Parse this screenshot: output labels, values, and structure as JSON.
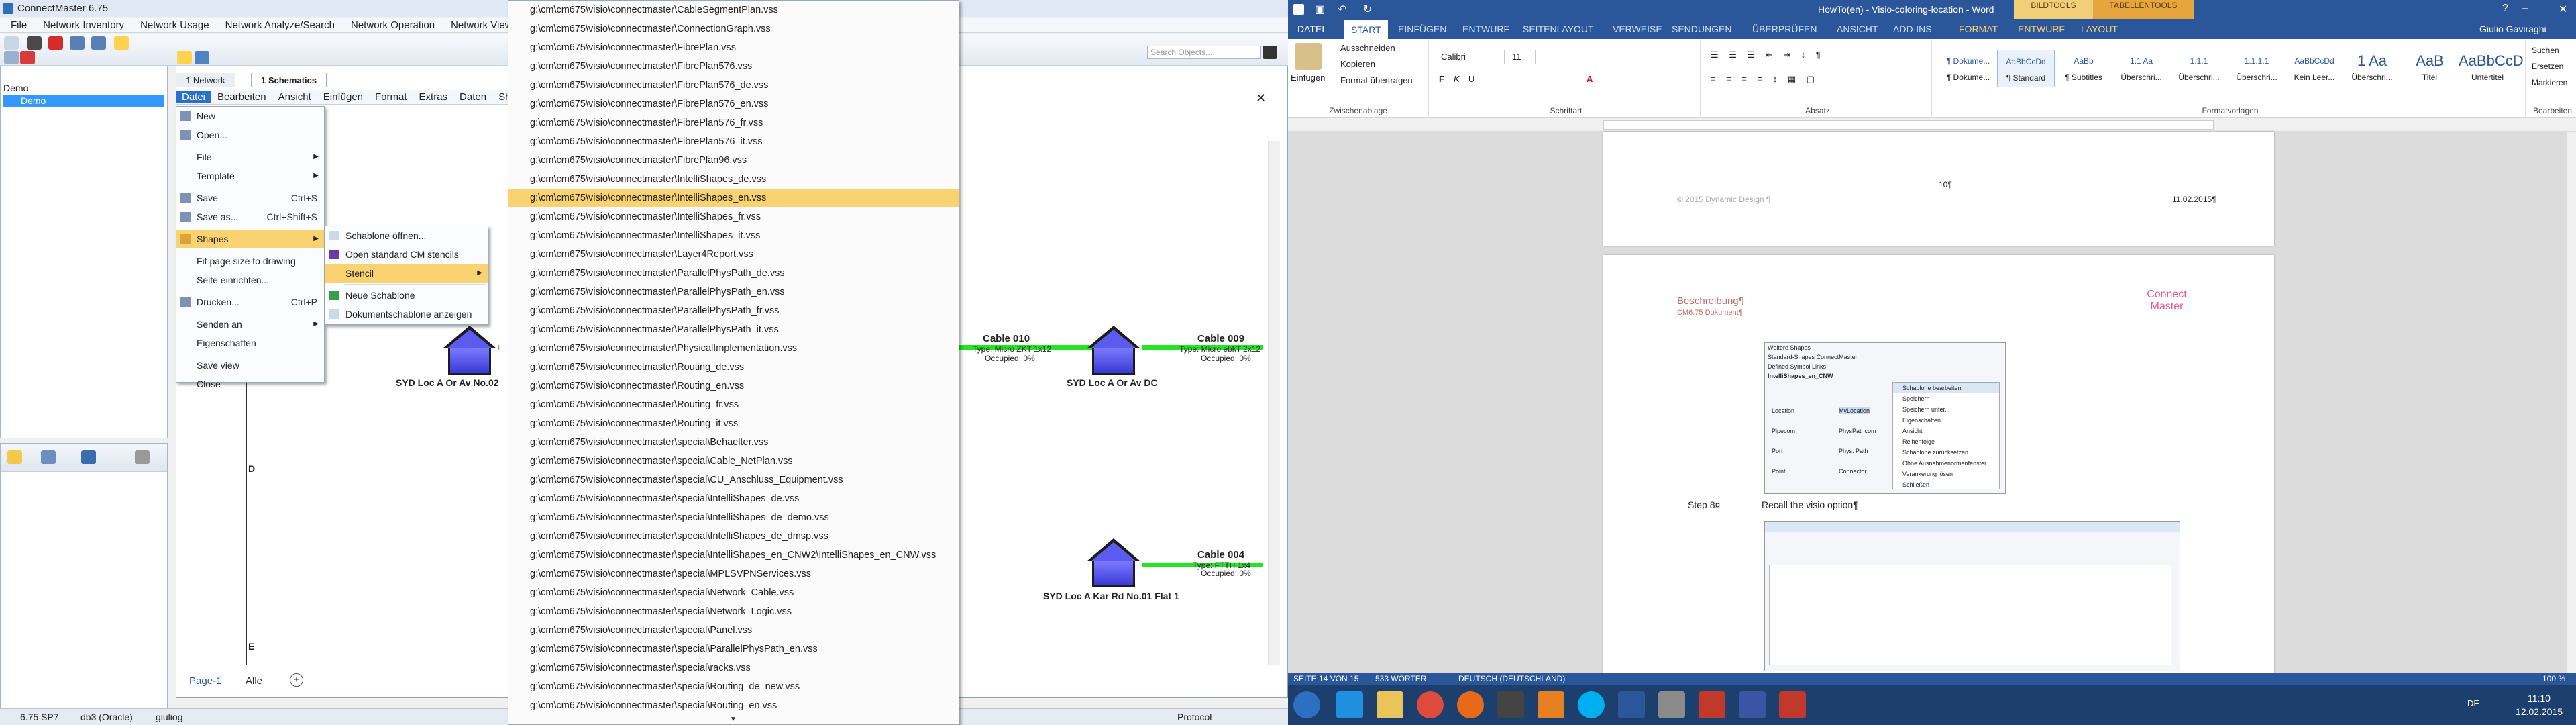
{
  "cm": {
    "title": "ConnectMaster 6.75",
    "menubar": [
      "File",
      "Network Inventory",
      "Network Usage",
      "Network Analyze/Search",
      "Network Operation",
      "Network View",
      "Co"
    ],
    "search_placeholder": "Search Objects...",
    "tree_root": "Demo",
    "tree_item": "Demo",
    "tabs": {
      "network": "1 Network",
      "schematics": "1 Schematics"
    },
    "submenu_bar": [
      "Datei",
      "Bearbeiten",
      "Ansicht",
      "Einfügen",
      "Format",
      "Extras",
      "Daten",
      "Sha"
    ],
    "datei_menu": [
      {
        "label": "New",
        "shortcut": ""
      },
      {
        "label": "Open...",
        "shortcut": ""
      },
      {
        "label": "File",
        "shortcut": "",
        "submenu": true
      },
      {
        "label": "Template",
        "shortcut": "",
        "submenu": true
      },
      {
        "label": "Save",
        "shortcut": "Ctrl+S"
      },
      {
        "label": "Save as...",
        "shortcut": "Ctrl+Shift+S"
      },
      {
        "label": "Shapes",
        "shortcut": "",
        "submenu": true,
        "highlighted": true
      },
      {
        "label": "Fit page size to drawing",
        "shortcut": ""
      },
      {
        "label": "Seite einrichten...",
        "shortcut": ""
      },
      {
        "label": "Drucken...",
        "shortcut": "Ctrl+P"
      },
      {
        "label": "Senden an",
        "shortcut": "",
        "submenu": true
      },
      {
        "label": "Eigenschaften",
        "shortcut": ""
      },
      {
        "label": "Save view",
        "shortcut": ""
      },
      {
        "label": "Close",
        "shortcut": ""
      }
    ],
    "shapes_menu": [
      "Schablone öffnen...",
      "Open standard CM stencils",
      "Stencil",
      "Neue Schablone",
      "Dokumentschablone anzeigen"
    ],
    "files": [
      "g:\\cm\\cm675\\visio\\connectmaster\\CableSegmentPlan.vss",
      "g:\\cm\\cm675\\visio\\connectmaster\\ConnectionGraph.vss",
      "g:\\cm\\cm675\\visio\\connectmaster\\FibrePlan.vss",
      "g:\\cm\\cm675\\visio\\connectmaster\\FibrePlan576.vss",
      "g:\\cm\\cm675\\visio\\connectmaster\\FibrePlan576_de.vss",
      "g:\\cm\\cm675\\visio\\connectmaster\\FibrePlan576_en.vss",
      "g:\\cm\\cm675\\visio\\connectmaster\\FibrePlan576_fr.vss",
      "g:\\cm\\cm675\\visio\\connectmaster\\FibrePlan576_it.vss",
      "g:\\cm\\cm675\\visio\\connectmaster\\FibrePlan96.vss",
      "g:\\cm\\cm675\\visio\\connectmaster\\IntelliShapes_de.vss",
      "g:\\cm\\cm675\\visio\\connectmaster\\IntelliShapes_en.vss",
      "g:\\cm\\cm675\\visio\\connectmaster\\IntelliShapes_fr.vss",
      "g:\\cm\\cm675\\visio\\connectmaster\\IntelliShapes_it.vss",
      "g:\\cm\\cm675\\visio\\connectmaster\\Layer4Report.vss",
      "g:\\cm\\cm675\\visio\\connectmaster\\ParallelPhysPath_de.vss",
      "g:\\cm\\cm675\\visio\\connectmaster\\ParallelPhysPath_en.vss",
      "g:\\cm\\cm675\\visio\\connectmaster\\ParallelPhysPath_fr.vss",
      "g:\\cm\\cm675\\visio\\connectmaster\\ParallelPhysPath_it.vss",
      "g:\\cm\\cm675\\visio\\connectmaster\\PhysicalImplementation.vss",
      "g:\\cm\\cm675\\visio\\connectmaster\\Routing_de.vss",
      "g:\\cm\\cm675\\visio\\connectmaster\\Routing_en.vss",
      "g:\\cm\\cm675\\visio\\connectmaster\\Routing_fr.vss",
      "g:\\cm\\cm675\\visio\\connectmaster\\Routing_it.vss",
      "g:\\cm\\cm675\\visio\\connectmaster\\special\\Behaelter.vss",
      "g:\\cm\\cm675\\visio\\connectmaster\\special\\Cable_NetPlan.vss",
      "g:\\cm\\cm675\\visio\\connectmaster\\special\\CU_Anschluss_Equipment.vss",
      "g:\\cm\\cm675\\visio\\connectmaster\\special\\IntelliShapes_de.vss",
      "g:\\cm\\cm675\\visio\\connectmaster\\special\\IntelliShapes_de_demo.vss",
      "g:\\cm\\cm675\\visio\\connectmaster\\special\\IntelliShapes_de_dmsp.vss",
      "g:\\cm\\cm675\\visio\\connectmaster\\special\\IntelliShapes_en_CNW2\\IntelliShapes_en_CNW.vss",
      "g:\\cm\\cm675\\visio\\connectmaster\\special\\MPLSVPNServices.vss",
      "g:\\cm\\cm675\\visio\\connectmaster\\special\\Network_Cable.vss",
      "g:\\cm\\cm675\\visio\\connectmaster\\special\\Network_Logic.vss",
      "g:\\cm\\cm675\\visio\\connectmaster\\special\\Panel.vss",
      "g:\\cm\\cm675\\visio\\connectmaster\\special\\ParallelPhysPath_en.vss",
      "g:\\cm\\cm675\\visio\\connectmaster\\special\\racks.vss",
      "g:\\cm\\cm675\\visio\\connectmaster\\special\\Routing_de_new.vss",
      "g:\\cm\\cm675\\visio\\connectmaster\\special\\Routing_en.vss"
    ],
    "highlighted_file_index": 10,
    "sites": [
      {
        "label": "SYD Loc A Or Av No.02"
      },
      {
        "label": "SYD Loc A Or Av DC"
      },
      {
        "label": "SYD Loc A Kar Rd No.01 Flat 1"
      }
    ],
    "cables": [
      {
        "name": "Cable 010",
        "type": "Type: Micro ZKT 1x12",
        "occ": "Occupied: 0%"
      },
      {
        "name": "Cable 009",
        "type": "Type: Micro ebkT 2x12",
        "occ": "Occupied: 0%"
      },
      {
        "name": "Cable 004",
        "type": "Type: FTTH 1x4",
        "occ": "Occupied: 0%"
      }
    ],
    "axis_letter_d": "D",
    "axis_letter_e": "E",
    "page_tab": "Page-1",
    "page_all": "Alle",
    "status": {
      "version": "6.75 SP7",
      "db": "db3 (Oracle)",
      "user": "giuliog",
      "protocol": "Protocol"
    }
  },
  "word": {
    "title": "HowTo(en) - Visio-coloring-location - Word",
    "bildtools": "BILDTOOLS",
    "tabellentools": "TABELLENTOOLS",
    "user": "Giulio Gaviraghi",
    "tabs": [
      "DATEI",
      "START",
      "EINFÜGEN",
      "ENTWURF",
      "SEITENLAYOUT",
      "VERWEISE",
      "SENDUNGEN",
      "ÜBERPRÜFEN",
      "ANSICHT",
      "ADD-INS",
      "FORMAT",
      "ENTWURF",
      "LAYOUT"
    ],
    "clipboard": {
      "paste": "Einfügen",
      "cut": "Ausschneiden",
      "copy": "Kopieren",
      "format": "Format übertragen",
      "label": "Zwischenablage"
    },
    "font": {
      "name": "Calibri",
      "size": "11",
      "label": "Schriftart"
    },
    "paragraph_label": "Absatz",
    "styles": [
      {
        "sample": "¶ Dokume...",
        "name": "¶ Dokume..."
      },
      {
        "sample": "AaBbCcDd",
        "name": "¶ Standard"
      },
      {
        "sample": "AaBb",
        "name": "¶ Subtitles"
      },
      {
        "sample": "1.1 Aa",
        "name": "Überschri..."
      },
      {
        "sample": "1.1.1",
        "name": "Überschri..."
      },
      {
        "sample": "1.1.1.1",
        "name": "Überschri..."
      },
      {
        "sample": "AaBbCcDd",
        "name": "Kein Leer..."
      },
      {
        "sample": "1 Aa",
        "name": "Überschri..."
      },
      {
        "sample": "AaB",
        "name": "Titel"
      },
      {
        "sample": "AaBbCcD",
        "name": "Untertitel"
      }
    ],
    "styles_label": "Formatvorlagen",
    "editing": {
      "find": "Suchen",
      "replace": "Ersetzen",
      "select": "Markieren",
      "label": "Bearbeiten"
    },
    "doc": {
      "page_number": "10¶",
      "copyright": "© 2015 Dynamic Design ¶",
      "date": "11.02.2015¶",
      "desc_label": "Beschreibung¶",
      "desc_sub": "CM6.75 Dokument¶",
      "logo": "Connect Master",
      "step": "Step 8¤",
      "step_text": "Recall the visio option¶",
      "shot_items": [
        "Weitere Shapes",
        "Standard-Shapes ConnectMaster",
        "Defined Symbol Links",
        "IntelliShapes_en_CNW",
        "Location",
        "MyLocation",
        "Pipecom",
        "PhysPathcom",
        "Port",
        "Phys. Path",
        "Point",
        "Connector"
      ],
      "shot_context": [
        "Schablone bearbeiten",
        "Speichern",
        "Speichern unter...",
        "Eigenschaften...",
        "Ansicht",
        "Reihenfolge",
        "Schablone zurücksetzen",
        "Ohne Ausnahmenormenfenster",
        "Verankerung lösen",
        "Schließen"
      ]
    },
    "status": {
      "page": "SEITE 14 VON 15",
      "words": "533 WÖRTER",
      "lang": "DEUTSCH (DEUTSCHLAND)",
      "zoom": "100 %"
    }
  },
  "taskbar": {
    "lang": "DE",
    "time": "11:10",
    "date": "12.02.2015"
  }
}
